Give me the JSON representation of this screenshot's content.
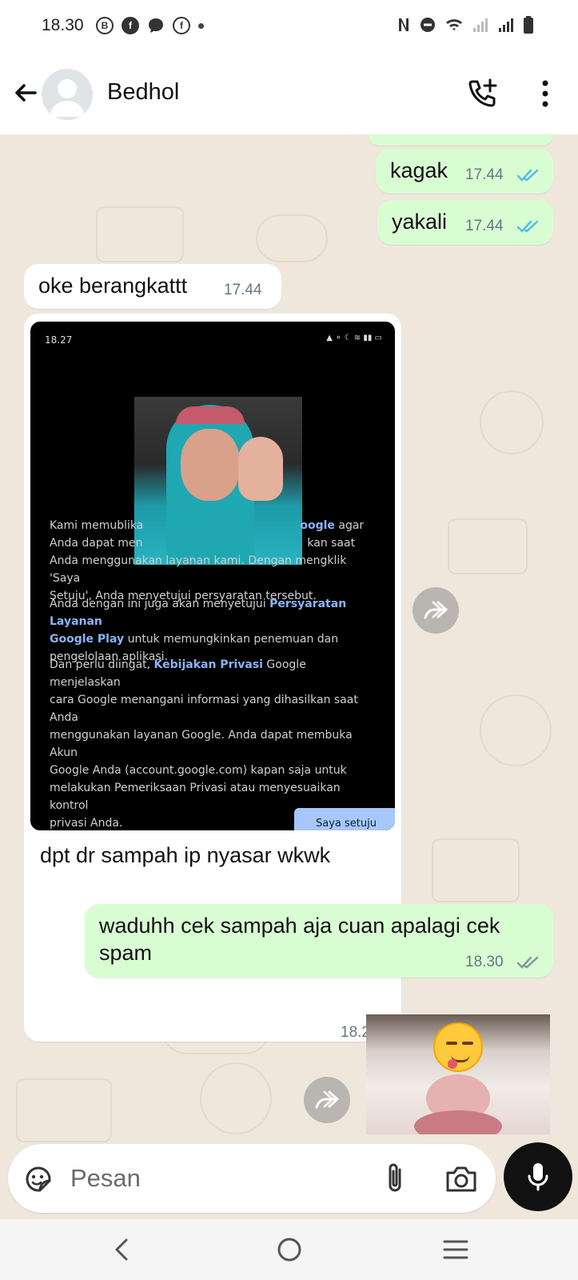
{
  "status_bar": {
    "time": "18.30",
    "left_icons": [
      "b-icon",
      "facebook-icon",
      "chat-bubble-icon",
      "messenger-icon"
    ],
    "right_icons": [
      "nfc-icon",
      "do-not-disturb-icon",
      "wifi-icon",
      "signal-icon",
      "battery-icon"
    ]
  },
  "header": {
    "contact_name": "Bedhol",
    "icons": [
      "back-arrow-icon",
      "avatar",
      "add-call-icon",
      "more-vertical-icon"
    ]
  },
  "messages": [
    {
      "id": "m1",
      "direction": "out",
      "text": "kagak",
      "time": "17.44",
      "status": "read"
    },
    {
      "id": "m2",
      "direction": "out",
      "text": "yakali",
      "time": "17.44",
      "status": "read"
    },
    {
      "id": "m3",
      "direction": "in",
      "text": "oke berangkattt",
      "time": "17.44"
    },
    {
      "id": "m4",
      "direction": "in",
      "type": "image",
      "caption": "dpt dr sampah ip nyasar wkwk",
      "time": "18.27"
    },
    {
      "id": "m5",
      "direction": "out",
      "text_line1": "waduhh cek sampah aja cuan apalagi cek",
      "text_line2": "spam",
      "time": "18.30",
      "status": "delivered"
    },
    {
      "id": "m6",
      "direction": "out",
      "type": "image"
    }
  ],
  "image_message": {
    "status_time": "18.27",
    "paragraph1_a": "Kami memublika",
    "paragraph1_link": "oogle",
    "paragraph1_b": "agar",
    "paragraph1_line2a": "Anda dapat men",
    "paragraph1_line2b": "kan saat",
    "paragraph1_line3": "Anda menggunakan layanan kami. Dengan mengklik 'Saya",
    "paragraph1_line4": "Setuju', Anda menyetujui persyaratan tersebut.",
    "paragraph2_a": "Anda dengan ini juga akan menyetujui ",
    "paragraph2_link1": "Persyaratan Layanan",
    "paragraph2_link2": "Google Play",
    "paragraph2_b": " untuk memungkinkan penemuan dan",
    "paragraph2_c": "pengelolaan aplikasi.",
    "paragraph3_a": "Dan perlu diingat, ",
    "paragraph3_link": "Kebijakan Privasi",
    "paragraph3_b": " Google menjelaskan",
    "paragraph3_c": "cara Google menangani informasi yang dihasilkan saat Anda",
    "paragraph3_d": "menggunakan layanan Google. Anda dapat membuka Akun",
    "paragraph3_e": "Google Anda (account.google.com) kapan saja untuk",
    "paragraph3_f": "melakukan Pemeriksaan Privasi atau menyesuaikan kontrol",
    "paragraph3_g": "privasi Anda.",
    "agree_button": "Saya setuju"
  },
  "composer": {
    "placeholder": "Pesan"
  },
  "colors": {
    "outgoing_bubble": "#d9fdd3",
    "incoming_bubble": "#ffffff",
    "chat_background": "#efe7dc",
    "read_tick": "#53bdeb",
    "link": "#8ab4f8"
  }
}
